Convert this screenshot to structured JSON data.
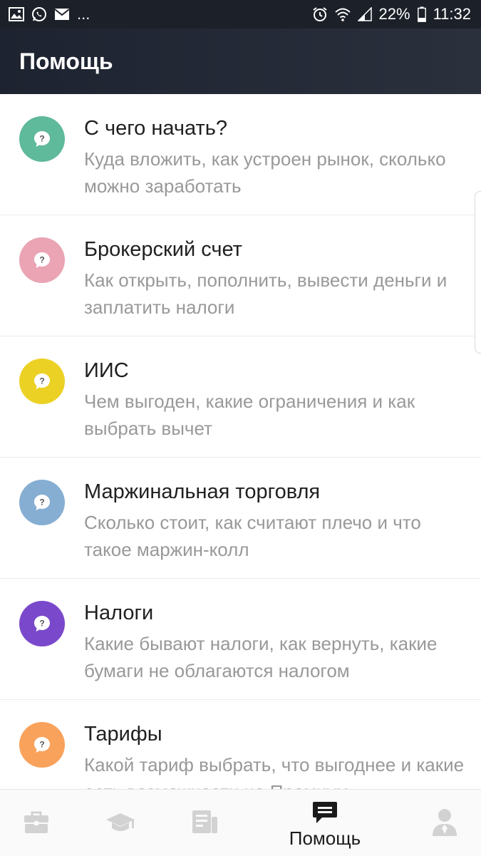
{
  "status": {
    "time": "11:32",
    "battery": "22%",
    "left_icons": [
      "image-icon",
      "whatsapp-icon",
      "mail-icon"
    ],
    "more": "..."
  },
  "header": {
    "title": "Помощь"
  },
  "topics": [
    {
      "title": "С чего начать?",
      "subtitle": "Куда вложить, как устроен рынок, сколько можно заработать",
      "color": "#5fb99b",
      "icon": "question-bubble-icon"
    },
    {
      "title": "Брокерский счет",
      "subtitle": "Как открыть, пополнить, вывести деньги и заплатить налоги",
      "color": "#eaa4b3",
      "icon": "question-bubble-icon"
    },
    {
      "title": "ИИС",
      "subtitle": "Чем выгоден, какие ограничения и как выбрать вычет",
      "color": "#ecd125",
      "icon": "question-bubble-icon"
    },
    {
      "title": "Маржинальная торговля",
      "subtitle": "Сколько стоит, как считают плечо и что такое маржин-колл",
      "color": "#86aed3",
      "icon": "question-bubble-icon"
    },
    {
      "title": "Налоги",
      "subtitle": "Какие бывают налоги, как вернуть, какие бумаги не облагаются налогом",
      "color": "#7a49cb",
      "icon": "question-bubble-icon"
    },
    {
      "title": "Тарифы",
      "subtitle": "Какой тариф выбрать, что выгоднее и какие есть возможности на Премиум",
      "color": "#f9a25c",
      "icon": "question-bubble-icon"
    }
  ],
  "bottom_nav": {
    "items": [
      {
        "icon": "briefcase-icon",
        "label": ""
      },
      {
        "icon": "graduation-cap-icon",
        "label": ""
      },
      {
        "icon": "news-icon",
        "label": ""
      },
      {
        "icon": "help-chat-icon",
        "label": "Помощь",
        "active": true
      },
      {
        "icon": "profile-icon",
        "label": ""
      }
    ]
  }
}
